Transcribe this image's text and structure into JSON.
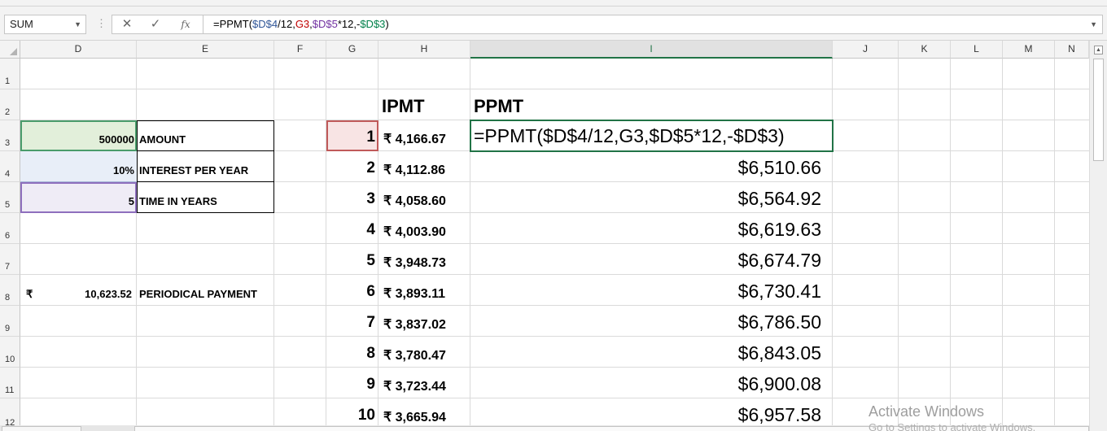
{
  "formula_bar": {
    "name_box": "SUM",
    "cancel_icon": "✕",
    "enter_icon": "✓",
    "fx_label": "fx",
    "formula_parts": [
      {
        "text": "=PPMT(",
        "color": "#000000"
      },
      {
        "text": "$D$4",
        "color": "#2f5597"
      },
      {
        "text": "/12,",
        "color": "#000000"
      },
      {
        "text": "G3",
        "color": "#c00000"
      },
      {
        "text": ",",
        "color": "#000000"
      },
      {
        "text": "$D$5",
        "color": "#7030a0"
      },
      {
        "text": "*12,-",
        "color": "#000000"
      },
      {
        "text": "$D$3",
        "color": "#00804a"
      },
      {
        "text": ")",
        "color": "#000000"
      }
    ]
  },
  "columns": [
    "D",
    "E",
    "F",
    "G",
    "H",
    "I",
    "J",
    "K",
    "L",
    "M",
    "N"
  ],
  "rows": [
    "1",
    "2",
    "3",
    "4",
    "5",
    "6",
    "7",
    "8",
    "9",
    "10",
    "11",
    "12"
  ],
  "headers": {
    "ipmt": "IPMT",
    "ppmt": "PPMT"
  },
  "inputs": [
    {
      "value": "500000",
      "label": "AMOUNT"
    },
    {
      "value": "10%",
      "label": "INTEREST PER YEAR"
    },
    {
      "value": "5",
      "label": "TIME IN YEARS"
    }
  ],
  "payment": {
    "currency": "₹",
    "value": "10,623.52",
    "label": "PERIODICAL PAYMENT"
  },
  "editing_formula": "=PPMT($D$4/12,G3,$D$5*12,-$D$3)",
  "schedule": [
    {
      "n": "1",
      "ipmt": "₹ 4,166.67",
      "ppmt": ""
    },
    {
      "n": "2",
      "ipmt": "₹ 4,112.86",
      "ppmt": "$6,510.66"
    },
    {
      "n": "3",
      "ipmt": "₹ 4,058.60",
      "ppmt": "$6,564.92"
    },
    {
      "n": "4",
      "ipmt": "₹ 4,003.90",
      "ppmt": "$6,619.63"
    },
    {
      "n": "5",
      "ipmt": "₹ 3,948.73",
      "ppmt": "$6,674.79"
    },
    {
      "n": "6",
      "ipmt": "₹ 3,893.11",
      "ppmt": "$6,730.41"
    },
    {
      "n": "7",
      "ipmt": "₹ 3,837.02",
      "ppmt": "$6,786.50"
    },
    {
      "n": "8",
      "ipmt": "₹ 3,780.47",
      "ppmt": "$6,843.05"
    },
    {
      "n": "9",
      "ipmt": "₹ 3,723.44",
      "ppmt": "$6,900.08"
    },
    {
      "n": "10",
      "ipmt": "₹ 3,665.94",
      "ppmt": "$6,957.58"
    }
  ],
  "watermark": {
    "line1": "Activate Windows",
    "line2": "Go to Settings to activate Windows."
  },
  "colors": {
    "accent_green": "#217346",
    "fill_green": "#e2efda",
    "fill_blue": "#e8eef8",
    "fill_purple": "#efecf6",
    "fill_pink": "#f8e4e4"
  }
}
